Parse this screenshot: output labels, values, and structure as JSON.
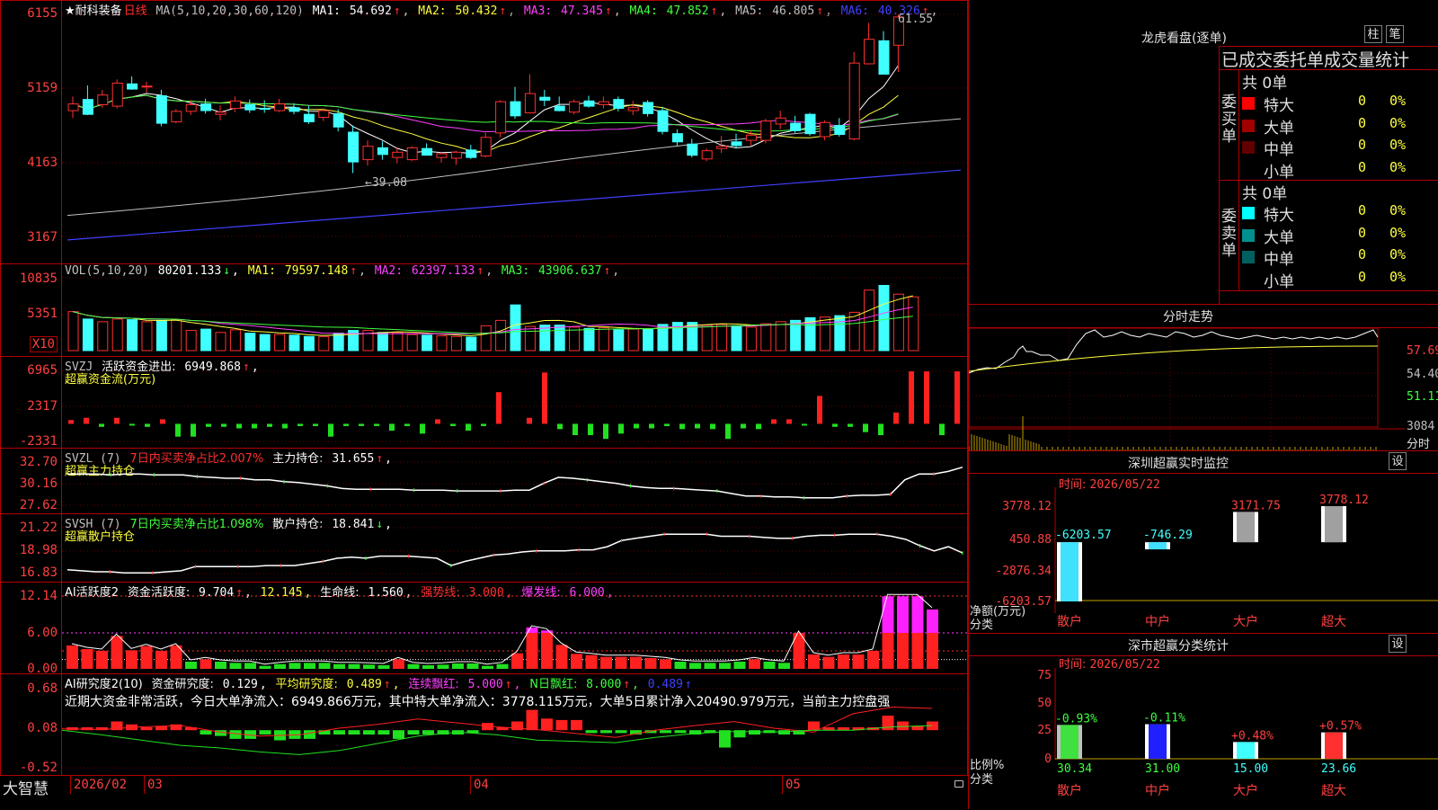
{
  "main": {
    "stock_name": "★耐科装备",
    "period": "日线",
    "ma_label": "MA(5,10,20,30,60,120)",
    "ma": [
      {
        "label": "MA1:",
        "value": "54.692",
        "arrow": "↑",
        "color": "#ffffff"
      },
      {
        "label": "MA2:",
        "value": "50.432",
        "arrow": "↑",
        "color": "#ffff40"
      },
      {
        "label": "MA3:",
        "value": "47.345",
        "arrow": "↑",
        "color": "#ff40ff"
      },
      {
        "label": "MA4:",
        "value": "47.852",
        "arrow": "↑",
        "color": "#40ff40"
      },
      {
        "label": "MA5:",
        "value": "46.805",
        "arrow": "↑",
        "color": "#c0c0c0"
      },
      {
        "label": "MA6:",
        "value": "40.326",
        "arrow": "↑",
        "color": "#4040ff"
      }
    ],
    "y_ticks": [
      "6155",
      "5159",
      "4163",
      "3167"
    ],
    "high_label": "61.55",
    "low_label": "←39.08"
  },
  "vol": {
    "label": "VOL(5,10,20)",
    "value": "80201.133",
    "value_arrow": "↓",
    "mas": [
      {
        "label": "MA1:",
        "value": "79597.148",
        "arrow": "↑",
        "color": "#ffff40"
      },
      {
        "label": "MA2:",
        "value": "62397.133",
        "arrow": "↑",
        "color": "#ff40ff"
      },
      {
        "label": "MA3:",
        "value": "43906.637",
        "arrow": "↑",
        "color": "#40ff40"
      }
    ],
    "y_ticks": [
      "10835",
      "5351"
    ],
    "unit": "X10"
  },
  "svzj": {
    "label": "SVZJ",
    "desc": "活跃资金进出:",
    "value": "6949.868",
    "arrow": "↑",
    "sub": "超赢资金流(万元)",
    "y_ticks": [
      "6965",
      "2317",
      "-2331"
    ]
  },
  "svzl": {
    "label": "SVZL (7)",
    "desc": "7日内买卖净占比2.007%",
    "k2": "主力持仓:",
    "v2": "31.655",
    "arrow": "↑",
    "sub": "超赢主力持仓",
    "y_ticks": [
      "32.70",
      "30.16",
      "27.62"
    ]
  },
  "svsh": {
    "label": "SVSH (7)",
    "desc": "7日内买卖净占比1.098%",
    "k2": "散户持仓:",
    "v2": "18.841",
    "arrow": "↓",
    "sub": "超赢散户持仓",
    "y_ticks": [
      "21.22",
      "18.98",
      "16.83"
    ]
  },
  "ai1": {
    "label": "AI活跃度2",
    "k1": "资金活跃度:",
    "v1": "9.704",
    "v2": "12.145",
    "k3": "生命线:",
    "v3": "1.560",
    "k4": "强势线:",
    "v4": "3.000",
    "k5": "爆发线:",
    "v5": "6.000",
    "y_ticks": [
      "12.14",
      "6.00",
      "0.00"
    ]
  },
  "ai2": {
    "label": "AI研究度2(10)",
    "k1": "资金研究度:",
    "v1": "0.129",
    "k2": "平均研究度:",
    "v2": "0.489",
    "k3": "连续飘红:",
    "v3": "5.000",
    "k4": "N日飘红:",
    "v4": "8.000",
    "v5": "0.489",
    "comment": "近期大资金非常活跃，今日大单净流入：6949.866万元，其中特大单净流入：3778.115万元，大单5日累计净入20490.979万元，当前主力控盘强",
    "y_ticks": [
      "0.68",
      "0.08",
      "-0.52"
    ]
  },
  "bottom": {
    "brand": "大智慧",
    "dates": [
      "2026/02",
      "03",
      "04",
      "05"
    ]
  },
  "longhu": {
    "title": "龙虎看盘(逐单)",
    "btn1": "柱",
    "btn2": "笔",
    "header": "已成交委托单成交量统计",
    "buy_label": "委买单",
    "sell_label": "委卖单",
    "buy_total": "共 0单",
    "sell_total": "共 0单",
    "buy_rows": [
      {
        "name": "特大",
        "count": "0",
        "pct": "0%",
        "color": "#ff0000"
      },
      {
        "name": "大单",
        "count": "0",
        "pct": "0%",
        "color": "#a00000"
      },
      {
        "name": "中单",
        "count": "0",
        "pct": "0%",
        "color": "#600000"
      },
      {
        "name": "小单",
        "count": "0",
        "pct": "0%",
        "color": ""
      }
    ],
    "sell_rows": [
      {
        "name": "特大",
        "count": "0",
        "pct": "0%",
        "color": "#00ffff"
      },
      {
        "name": "大单",
        "count": "0",
        "pct": "0%",
        "color": "#009090"
      },
      {
        "name": "中单",
        "count": "0",
        "pct": "0%",
        "color": "#006060"
      },
      {
        "name": "小单",
        "count": "0",
        "pct": "0%",
        "color": ""
      }
    ]
  },
  "fenshi": {
    "title": "分时走势",
    "y_ticks": [
      "57.69",
      "54.40",
      "51.11"
    ],
    "vol_tick": "3084",
    "vol_unit": "分时"
  },
  "sz_monitor": {
    "title": "深圳超赢实时监控",
    "settings": "设",
    "time_label": "时间:",
    "time": "2026/05/22",
    "y_ticks": [
      "3778.12",
      "450.88",
      "-2876.34",
      "-6203.57"
    ],
    "y_unit": "净额(万元)",
    "x_unit": "分类",
    "bars": [
      {
        "name": "散户",
        "value": -6203.57,
        "label": "-6203.57"
      },
      {
        "name": "中户",
        "value": -746.29,
        "label": "-746.29"
      },
      {
        "name": "大户",
        "value": 3171.75,
        "label": "3171.75"
      },
      {
        "name": "超大",
        "value": 3778.12,
        "label": "3778.12"
      }
    ]
  },
  "sz_class": {
    "title": "深市超赢分类统计",
    "settings": "设",
    "time_label": "时间:",
    "time": "2026/05/22",
    "y_ticks": [
      "75",
      "50",
      "25",
      "0"
    ],
    "y_unit": "比例%",
    "x_unit": "分类",
    "bars": [
      {
        "name": "散户",
        "value": 30.34,
        "label": "30.34",
        "change": "-0.93%"
      },
      {
        "name": "中户",
        "value": 31.0,
        "label": "31.00",
        "change": "-0.11%"
      },
      {
        "name": "大户",
        "value": 15.0,
        "label": "15.00",
        "change": "+0.48%"
      },
      {
        "name": "超大",
        "value": 23.66,
        "label": "23.66",
        "change": "+0.57%"
      }
    ]
  },
  "chart_data": [
    {
      "type": "candlestick",
      "y_ticks": [
        31.67,
        41.63,
        51.59,
        61.55
      ],
      "ylim": [
        30.0,
        62.6
      ],
      "ohlc": [
        [
          48.6,
          50.5,
          47.6,
          49.5
        ],
        [
          50.1,
          52.0,
          48.0,
          48.1
        ],
        [
          49.4,
          51.4,
          49.0,
          50.7
        ],
        [
          49.2,
          52.8,
          48.9,
          52.3
        ],
        [
          52.2,
          53.2,
          51.4,
          51.5
        ],
        [
          51.8,
          52.5,
          51.0,
          51.9
        ],
        [
          50.6,
          51.4,
          46.5,
          46.9
        ],
        [
          47.1,
          48.8,
          46.9,
          48.5
        ],
        [
          48.5,
          50.0,
          48.0,
          49.4
        ],
        [
          49.5,
          50.2,
          48.2,
          48.6
        ],
        [
          48.1,
          49.3,
          47.3,
          48.4
        ],
        [
          48.9,
          50.5,
          48.4,
          49.9
        ],
        [
          49.4,
          50.1,
          48.3,
          48.7
        ],
        [
          48.9,
          50.0,
          48.3,
          48.8
        ],
        [
          48.6,
          50.2,
          48.4,
          49.5
        ],
        [
          49.0,
          49.6,
          48.1,
          48.5
        ],
        [
          48.1,
          49.2,
          46.8,
          47.1
        ],
        [
          47.7,
          48.9,
          47.2,
          48.6
        ],
        [
          48.2,
          48.8,
          45.8,
          46.4
        ],
        [
          45.7,
          46.6,
          40.2,
          41.7
        ],
        [
          42.0,
          44.6,
          41.2,
          43.8
        ],
        [
          43.6,
          44.5,
          42.0,
          42.7
        ],
        [
          42.3,
          43.7,
          41.5,
          43.0
        ],
        [
          42.0,
          43.8,
          41.8,
          43.6
        ],
        [
          43.5,
          44.2,
          42.6,
          42.6
        ],
        [
          42.3,
          43.0,
          41.6,
          42.8
        ],
        [
          42.2,
          43.2,
          41.3,
          43.0
        ],
        [
          43.3,
          44.0,
          42.1,
          42.3
        ],
        [
          42.5,
          45.6,
          42.3,
          45.0
        ],
        [
          45.6,
          50.0,
          45.0,
          49.8
        ],
        [
          49.8,
          51.8,
          47.5,
          47.9
        ],
        [
          48.3,
          53.5,
          48.2,
          50.9
        ],
        [
          50.4,
          51.4,
          49.2,
          50.0
        ],
        [
          49.2,
          50.5,
          48.5,
          48.6
        ],
        [
          48.4,
          50.1,
          48.1,
          49.8
        ],
        [
          49.9,
          50.6,
          49.0,
          49.2
        ],
        [
          49.4,
          50.5,
          48.9,
          49.8
        ],
        [
          50.1,
          50.5,
          48.5,
          48.9
        ],
        [
          48.6,
          49.9,
          48.0,
          49.0
        ],
        [
          49.7,
          50.0,
          47.8,
          48.2
        ],
        [
          48.6,
          49.1,
          45.4,
          45.8
        ],
        [
          45.5,
          46.1,
          43.9,
          44.4
        ],
        [
          44.1,
          44.8,
          42.3,
          42.6
        ],
        [
          42.1,
          43.5,
          41.8,
          43.2
        ],
        [
          43.5,
          45.2,
          42.9,
          43.8
        ],
        [
          44.4,
          45.5,
          43.5,
          43.9
        ],
        [
          44.6,
          45.9,
          43.9,
          45.3
        ],
        [
          44.6,
          47.5,
          44.2,
          47.2
        ],
        [
          46.8,
          48.6,
          46.1,
          47.6
        ],
        [
          46.9,
          47.9,
          45.6,
          45.9
        ],
        [
          48.1,
          48.3,
          45.2,
          45.5
        ],
        [
          45.1,
          47.3,
          44.6,
          47.0
        ],
        [
          46.6,
          47.6,
          45.1,
          45.4
        ],
        [
          44.8,
          56.5,
          44.6,
          55.0
        ],
        [
          54.9,
          60.4,
          54.8,
          58.2
        ],
        [
          58.0,
          59.3,
          53.5,
          53.5
        ],
        [
          57.4,
          61.55,
          53.8,
          61.2
        ]
      ]
    },
    {
      "type": "bar",
      "name": "VOL",
      "y_ticks": [
        5351,
        10835
      ],
      "values": [
        5800,
        4700,
        4300,
        4700,
        4600,
        4300,
        4500,
        4600,
        3000,
        3200,
        2700,
        3100,
        2600,
        2400,
        2400,
        2300,
        2100,
        2100,
        2600,
        3000,
        3000,
        2700,
        2700,
        2400,
        2300,
        2200,
        2100,
        2000,
        3700,
        4500,
        6800,
        3600,
        3800,
        3800,
        3500,
        3300,
        3400,
        3100,
        3200,
        3200,
        3900,
        4200,
        4200,
        3800,
        3900,
        3700,
        3500,
        4000,
        4300,
        4500,
        4900,
        5000,
        5200,
        5700,
        9000,
        9700,
        8400,
        8000
      ]
    },
    {
      "type": "bar",
      "name": "超赢资金流(万元)",
      "y_ticks": [
        -2331,
        2317,
        6965
      ],
      "values": [
        500,
        800,
        -400,
        800,
        -200,
        -400,
        600,
        -1700,
        -1700,
        -400,
        -400,
        -600,
        -600,
        -400,
        -600,
        -300,
        -300,
        -1700,
        -300,
        -300,
        -300,
        -900,
        -300,
        -1300,
        600,
        -300,
        -900,
        -300,
        4200,
        0,
        800,
        6800,
        -700,
        -1500,
        -1500,
        -2000,
        -1300,
        -600,
        -600,
        -300,
        -700,
        -600,
        -700,
        -2000,
        -600,
        -700,
        600,
        600,
        -200,
        3700,
        -400,
        -400,
        -1100,
        -1500,
        1500,
        6950,
        6950,
        -1500,
        6950
      ]
    },
    {
      "type": "line",
      "name": "超赢主力持仓",
      "y_ticks": [
        27.62,
        30.16,
        32.7
      ],
      "values": [
        31.3,
        31.3,
        31.3,
        31.2,
        31.3,
        31.3,
        31.2,
        31.2,
        31.2,
        31.0,
        30.9,
        30.8,
        30.8,
        30.6,
        30.6,
        30.4,
        30.3,
        30.1,
        29.9,
        29.6,
        29.5,
        29.5,
        29.5,
        29.5,
        29.4,
        29.4,
        29.4,
        29.3,
        29.3,
        29.3,
        29.3,
        29.4,
        29.4,
        30.2,
        30.9,
        30.8,
        30.6,
        30.4,
        30.2,
        29.9,
        29.7,
        29.6,
        29.6,
        29.5,
        29.4,
        29.3,
        29.0,
        28.7,
        28.7,
        28.6,
        28.6,
        28.5,
        28.5,
        28.5,
        28.7,
        28.8,
        28.8,
        28.9,
        30.6,
        31.3,
        31.3,
        31.6,
        32.1
      ]
    },
    {
      "type": "line",
      "name": "超赢散户持仓",
      "y_ticks": [
        16.83,
        18.98,
        21.22
      ],
      "values": [
        17.2,
        17.1,
        17.0,
        17.0,
        16.9,
        16.9,
        16.9,
        17.0,
        17.1,
        17.5,
        17.5,
        17.5,
        17.5,
        17.5,
        17.6,
        17.6,
        17.6,
        17.8,
        18.0,
        18.3,
        18.4,
        18.3,
        18.5,
        18.5,
        18.5,
        18.4,
        18.3,
        17.6,
        18.0,
        18.3,
        18.6,
        18.7,
        18.9,
        19.0,
        19.0,
        19.0,
        19.1,
        19.1,
        19.4,
        20.0,
        20.2,
        20.4,
        20.6,
        20.6,
        20.6,
        20.6,
        20.4,
        20.4,
        20.4,
        20.3,
        20.2,
        20.2,
        20.4,
        20.5,
        20.5,
        20.6,
        20.6,
        20.6,
        20.4,
        20.1,
        19.5,
        19.0,
        19.4,
        18.8
      ]
    },
    {
      "type": "bar",
      "name": "AI活跃度2",
      "y_ticks": [
        0.0,
        6.0,
        12.14
      ],
      "values": [
        3.9,
        3.3,
        3.0,
        5.5,
        3.1,
        3.8,
        3.0,
        3.9,
        1.2,
        1.6,
        1.2,
        1.0,
        1.0,
        0.5,
        0.8,
        1.0,
        1.0,
        1.0,
        0.8,
        0.8,
        0.7,
        0.6,
        1.6,
        0.8,
        0.6,
        0.7,
        0.9,
        0.9,
        0.5,
        0.8,
        2.6,
        6.9,
        6.4,
        4.0,
        2.5,
        2.3,
        2.0,
        2.0,
        2.0,
        1.8,
        1.6,
        1.2,
        1.0,
        1.0,
        1.0,
        1.2,
        1.6,
        1.2,
        1.0,
        6.0,
        2.4,
        2.0,
        2.4,
        2.4,
        3.0,
        12.1,
        12.1,
        12.1,
        9.9
      ]
    },
    {
      "type": "bar",
      "name": "AI研究度2(10)",
      "y_ticks": [
        -0.52,
        0.08,
        0.68
      ],
      "values": [
        0.02,
        0.02,
        0.02,
        0.06,
        0.04,
        0.02,
        0.03,
        0.04,
        0.02,
        -0.03,
        -0.04,
        -0.06,
        -0.06,
        -0.03,
        -0.07,
        -0.06,
        -0.06,
        -0.03,
        -0.03,
        -0.03,
        -0.03,
        -0.03,
        -0.06,
        -0.03,
        -0.03,
        -0.03,
        -0.03,
        -0.02,
        0.05,
        0.02,
        0.06,
        0.14,
        0.08,
        0.07,
        0.07,
        -0.02,
        -0.02,
        -0.02,
        -0.03,
        -0.02,
        -0.02,
        -0.02,
        -0.03,
        -0.02,
        -0.12,
        -0.05,
        -0.03,
        -0.02,
        -0.03,
        -0.03,
        0.06,
        0.02,
        0.02,
        0.02,
        0.02,
        0.1,
        0.06,
        0.03,
        0.06
      ]
    }
  ]
}
